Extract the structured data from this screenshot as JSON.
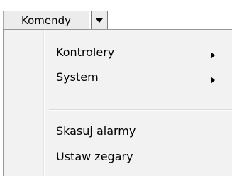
{
  "toolbar": {
    "button_label": "Komendy",
    "dropdown_icon": "chevron-down-icon"
  },
  "menu": {
    "items": [
      {
        "label": "Kontrolery",
        "has_submenu": true
      },
      {
        "label": "System",
        "has_submenu": true
      },
      {
        "label": "Skasuj alarmy",
        "has_submenu": false
      },
      {
        "label": "Ustaw zegary",
        "has_submenu": false
      }
    ]
  },
  "colors": {
    "menu_background": "#f2f2f2",
    "button_background": "#ececec",
    "border": "#979797"
  }
}
